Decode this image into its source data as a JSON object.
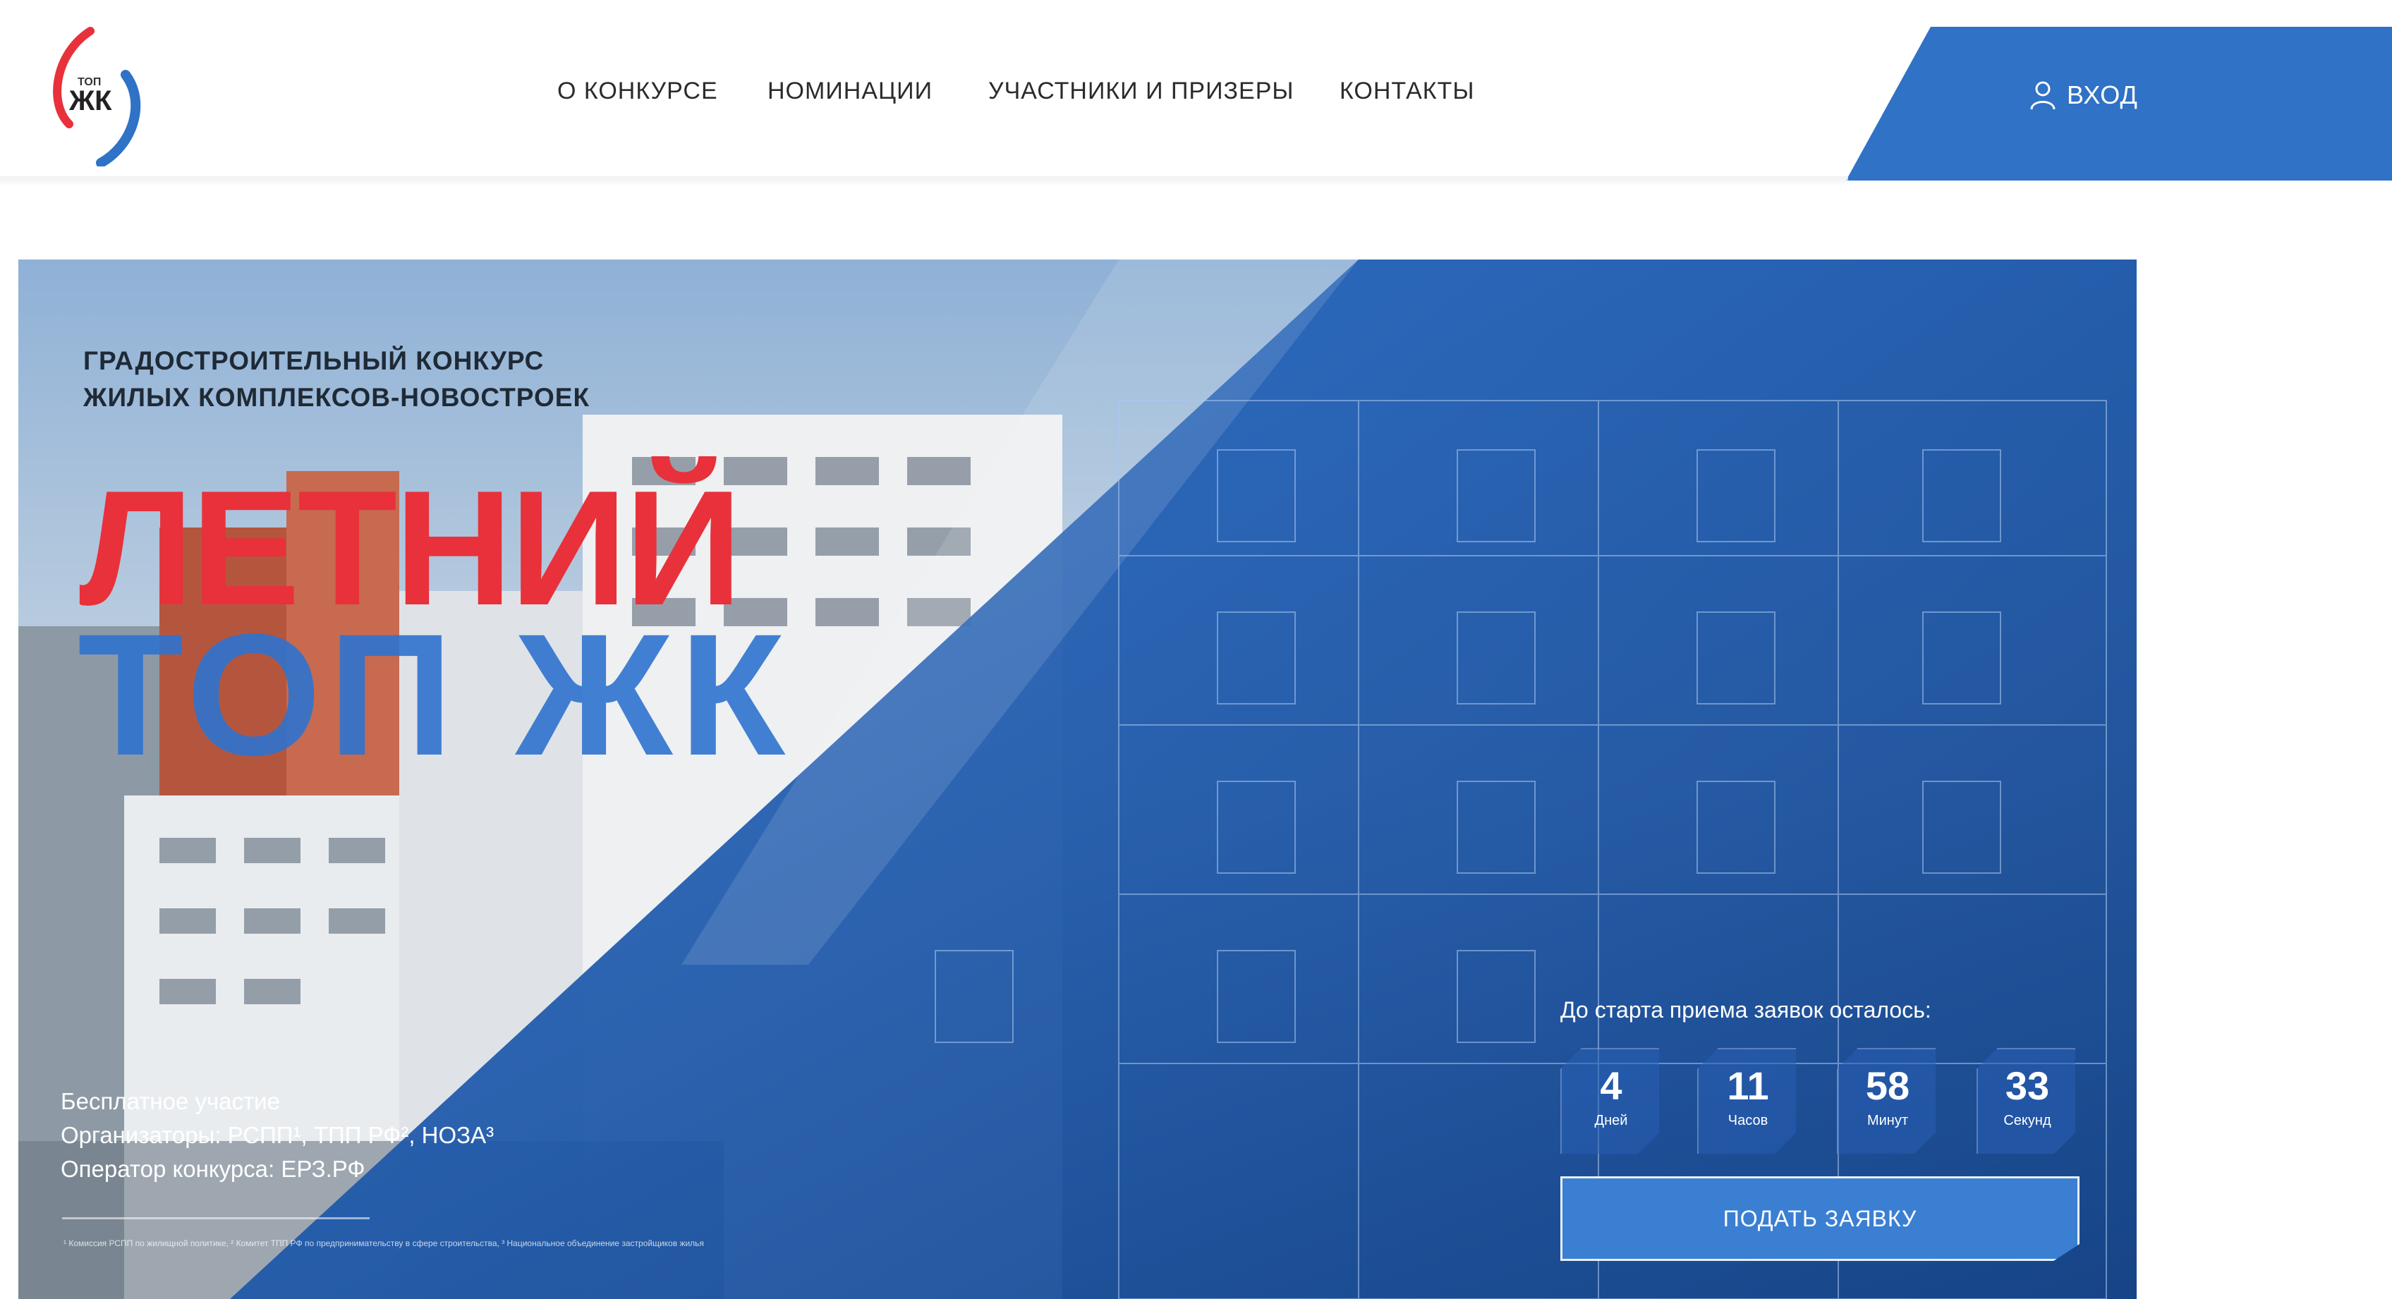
{
  "header": {
    "logo_text_small": "ТОП",
    "logo_text": "ЖК",
    "nav": [
      {
        "label": "О КОНКУРСЕ"
      },
      {
        "label": "НОМИНАЦИИ"
      },
      {
        "label": "УЧАСТНИКИ И ПРИЗЕРЫ"
      },
      {
        "label": "КОНТАКТЫ"
      }
    ],
    "login_label": "ВХОД",
    "login_icon": "user-icon"
  },
  "hero": {
    "subtitle_line1": "ГРАДОСТРОИТЕЛЬНЫЙ КОНКУРС",
    "subtitle_line2": "ЖИЛЫХ КОМПЛЕКСОВ-НОВОСТРОЕК",
    "title_red": "ЛЕТНИЙ",
    "title_blue": "ТОП ЖК",
    "info": [
      "Бесплатное участие",
      "Организаторы: РСПП¹, ТПП РФ², НОЗА³",
      "Оператор конкурса: ЕРЗ.РФ"
    ],
    "footnote": "¹ Комиссия РСПП по жилищной политике, ² Комитет ТПП РФ по предпринимательству в сфере строительства, ³ Национальное объединение застройщиков жилья",
    "countdown_label": "До старта приема заявок осталось:",
    "countdown": [
      {
        "value": "4",
        "unit": "Дней"
      },
      {
        "value": "11",
        "unit": "Часов"
      },
      {
        "value": "58",
        "unit": "Минут"
      },
      {
        "value": "33",
        "unit": "Секунд"
      }
    ],
    "apply_label": "ПОДАТЬ ЗАЯВКУ"
  },
  "colors": {
    "brand_blue": "#2f72c6",
    "brand_red": "#e8313a",
    "hero_blue": "#1f5fb3"
  }
}
